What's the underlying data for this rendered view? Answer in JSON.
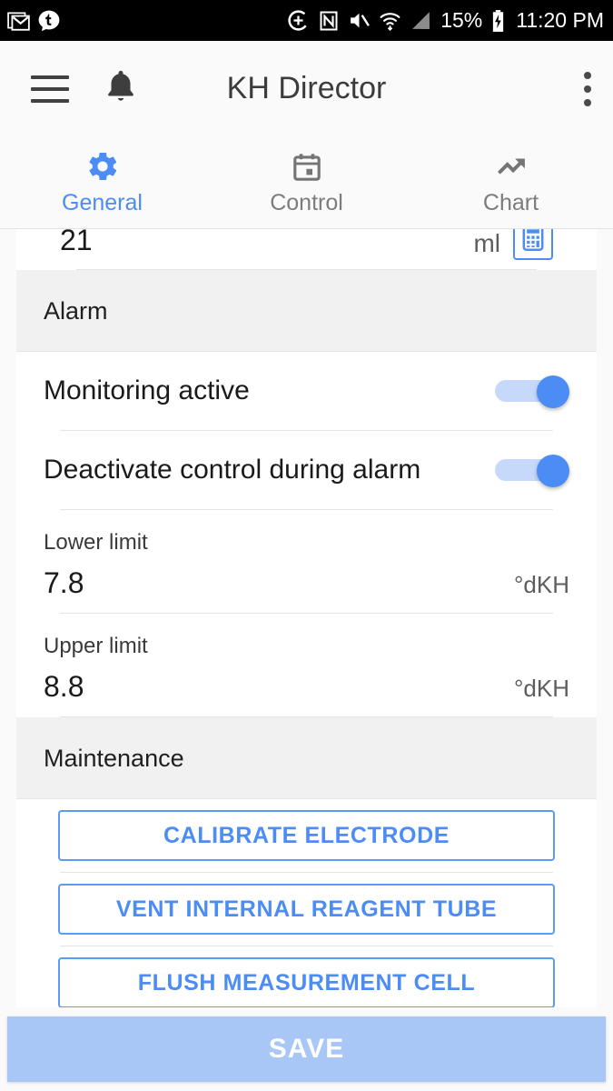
{
  "status_bar": {
    "left_icons": [
      "gmail-icon",
      "tumblr-icon"
    ],
    "right_icons": [
      "sync-icon",
      "nfc-icon",
      "mute-icon",
      "wifi-icon",
      "signal-icon"
    ],
    "battery_percent": "15%",
    "battery_state": "charging",
    "clock": "11:20 PM"
  },
  "appbar": {
    "menu_icon": "hamburger-icon",
    "bell_icon": "notification-bell-icon",
    "title": "KH Director",
    "overflow_icon": "more-vert-icon"
  },
  "tabs": [
    {
      "label": "General",
      "icon": "gear-icon",
      "active": true
    },
    {
      "label": "Control",
      "icon": "calendar-icon",
      "active": false
    },
    {
      "label": "Chart",
      "icon": "trending-up-icon",
      "active": false
    }
  ],
  "partial_row": {
    "value": "21",
    "unit": "ml",
    "button_icon": "calculator-icon"
  },
  "sections": {
    "alarm": {
      "header": "Alarm",
      "monitoring": {
        "label": "Monitoring active",
        "state": "on"
      },
      "deactivate": {
        "label": "Deactivate control during alarm",
        "state": "on"
      },
      "lower_limit": {
        "caption": "Lower limit",
        "value": "7.8",
        "unit": "°dKH"
      },
      "upper_limit": {
        "caption": "Upper limit",
        "value": "8.8",
        "unit": "°dKH"
      }
    },
    "maintenance": {
      "header": "Maintenance",
      "buttons": [
        "CALIBRATE ELECTRODE",
        "VENT INTERNAL REAGENT TUBE",
        "FLUSH MEASUREMENT CELL"
      ]
    }
  },
  "footer": {
    "save_label": "SAVE"
  },
  "colors": {
    "accent": "#4C8CF5",
    "accent_light": "#A8C7F7",
    "section_bg": "#F1F1F1",
    "text_primary": "#1A1A1A",
    "text_secondary": "#5D5D5D"
  }
}
